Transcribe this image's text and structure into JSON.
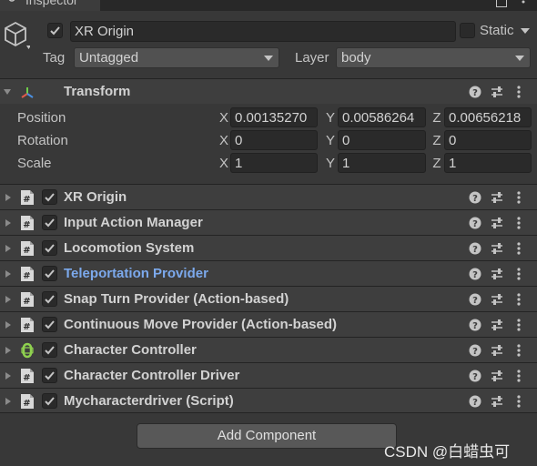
{
  "window": {
    "tab_title": "Inspector"
  },
  "header": {
    "object_active": true,
    "object_name": "XR Origin",
    "static_label": "Static",
    "static_checked": false,
    "tag_label": "Tag",
    "tag_value": "Untagged",
    "layer_label": "Layer",
    "layer_value": "body"
  },
  "transform": {
    "title": "Transform",
    "rows": [
      {
        "label": "Position",
        "x": "0.00135270",
        "y": "0.00586264",
        "z": "0.00656218"
      },
      {
        "label": "Rotation",
        "x": "0",
        "y": "0",
        "z": "0"
      },
      {
        "label": "Scale",
        "x": "1",
        "y": "1",
        "z": "1"
      }
    ],
    "axis_x": "X",
    "axis_y": "Y",
    "axis_z": "Z"
  },
  "components": [
    {
      "name": "XR Origin",
      "icon": "script-icon",
      "enabled": true,
      "link": false
    },
    {
      "name": "Input Action Manager",
      "icon": "script-icon",
      "enabled": true,
      "link": false
    },
    {
      "name": "Locomotion System",
      "icon": "script-icon",
      "enabled": true,
      "link": false
    },
    {
      "name": "Teleportation Provider",
      "icon": "script-icon",
      "enabled": true,
      "link": true
    },
    {
      "name": "Snap Turn Provider (Action-based)",
      "icon": "script-icon",
      "enabled": true,
      "link": false
    },
    {
      "name": "Continuous Move Provider (Action-based)",
      "icon": "script-icon",
      "enabled": true,
      "link": false
    },
    {
      "name": "Character Controller",
      "icon": "character-controller-icon",
      "enabled": true,
      "link": false
    },
    {
      "name": "Character Controller Driver",
      "icon": "script-icon",
      "enabled": true,
      "link": false
    },
    {
      "name": "Mycharacterdriver (Script)",
      "icon": "script-icon",
      "enabled": true,
      "link": false
    }
  ],
  "add_component_label": "Add Component",
  "watermark": "CSDN @白蜡虫可",
  "colors": {
    "background": "#383838",
    "link": "#7ca9ec",
    "check": "#c4c4c4"
  }
}
